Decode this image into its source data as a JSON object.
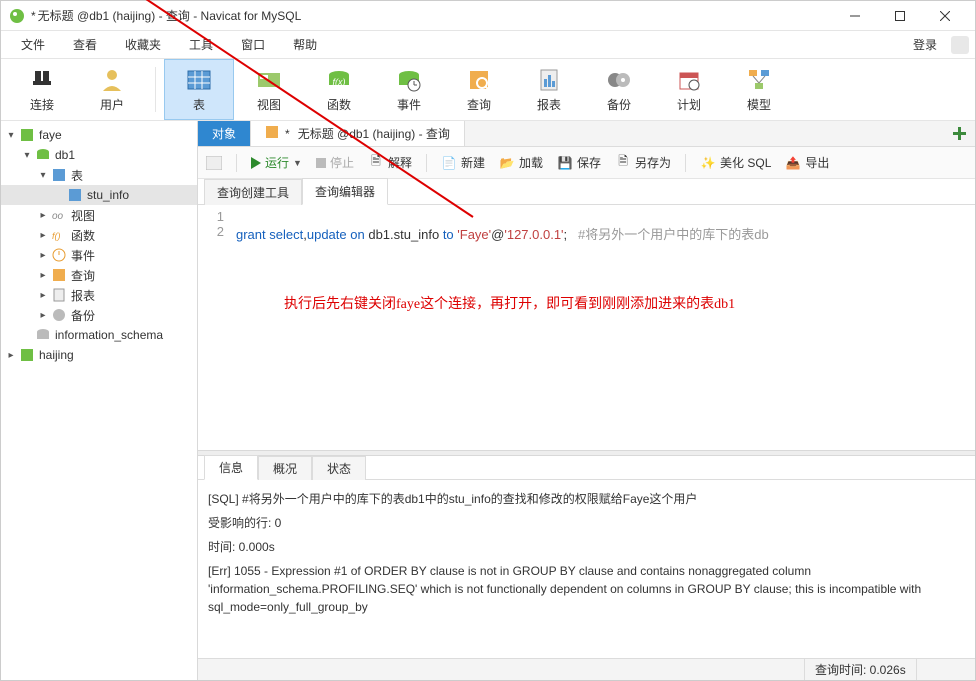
{
  "title": {
    "dirty_marker": "*",
    "text": "无标题 @db1 (haijing) - 查询 - Navicat for MySQL"
  },
  "menu": {
    "file": "文件",
    "view": "查看",
    "fav": "收藏夹",
    "tool": "工具",
    "window": "窗口",
    "help": "帮助",
    "login": "登录"
  },
  "toolbar": {
    "conn": "连接",
    "user": "用户",
    "table": "表",
    "view": "视图",
    "func": "函数",
    "event": "事件",
    "query": "查询",
    "report": "报表",
    "backup": "备份",
    "plan": "计划",
    "model": "模型"
  },
  "tree": {
    "faye": "faye",
    "db1": "db1",
    "table": "表",
    "stu_info": "stu_info",
    "view": "视图",
    "func": "函数",
    "event": "事件",
    "query": "查询",
    "report": "报表",
    "backup": "备份",
    "info_schema": "information_schema",
    "haijing": "haijing"
  },
  "tabs": {
    "objects": "对象",
    "query_dirty": "*",
    "query_title": "无标题 @db1 (haijing) - 查询"
  },
  "actions": {
    "run": "运行",
    "stop": "停止",
    "explain": "解释",
    "new": "新建",
    "load": "加载",
    "save": "保存",
    "saveas": "另存为",
    "beautify": "美化 SQL",
    "export": "导出"
  },
  "subtabs": {
    "builder": "查询创建工具",
    "editor": "查询编辑器"
  },
  "sql": {
    "line1": "1",
    "line2": "2",
    "code_pre": "grant",
    "code_kw2": "select",
    "code_comma": ",",
    "code_kw3": "update",
    "code_on": "on",
    "code_tbl": "db1.stu_info",
    "code_to": "to",
    "code_str": "'Faye'",
    "code_at": "@",
    "code_host": "'127.0.0.1'",
    "code_semi": ";",
    "code_cmt": "#将另外一个用户中的库下的表db"
  },
  "annotation": "执行后先右键关闭faye这个连接，再打开，即可看到刚刚添加进来的表db1",
  "bottom_tabs": {
    "info": "信息",
    "profile": "概况",
    "status": "状态"
  },
  "output": {
    "l1": "[SQL]  #将另外一个用户中的库下的表db1中的stu_info的查找和修改的权限赋给Faye这个用户",
    "l2": "受影响的行: 0",
    "l3": "时间: 0.000s",
    "l4": "[Err] 1055 - Expression #1 of ORDER BY clause is not in GROUP BY clause and contains nonaggregated column 'information_schema.PROFILING.SEQ' which is not functionally dependent on columns in GROUP BY clause; this is incompatible with sql_mode=only_full_group_by"
  },
  "status": {
    "time": "查询时间: 0.026s"
  }
}
